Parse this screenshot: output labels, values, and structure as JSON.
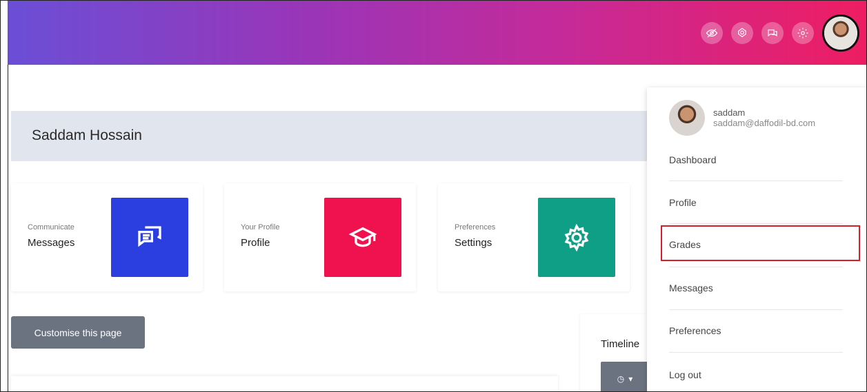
{
  "header": {
    "icons": [
      "eye-off-icon",
      "notification-icon",
      "chat-icon",
      "settings-icon"
    ],
    "gradient": [
      "#6a4fd6",
      "#9a35b8",
      "#c62a98",
      "#ee1d62"
    ]
  },
  "page": {
    "title": "Saddam Hossain"
  },
  "tiles": [
    {
      "small": "Communicate",
      "big": "Messages",
      "color": "#2b3fe0",
      "icon": "chat-bubbles-icon"
    },
    {
      "small": "Your Profile",
      "big": "Profile",
      "color": "#f0124f",
      "icon": "graduation-cap-icon"
    },
    {
      "small": "Preferences",
      "big": "Settings",
      "color": "#0f9e86",
      "icon": "gear-icon"
    }
  ],
  "customise_button": "Customise this page",
  "timeline": {
    "label": "Timeline"
  },
  "user_menu": {
    "name": "saddam",
    "email": "saddam@daffodil-bd.com",
    "items": [
      "Dashboard",
      "Profile",
      "Grades",
      "Messages",
      "Preferences",
      "Log out"
    ],
    "highlighted": "Grades",
    "highlight_color": "#d21f2b"
  }
}
